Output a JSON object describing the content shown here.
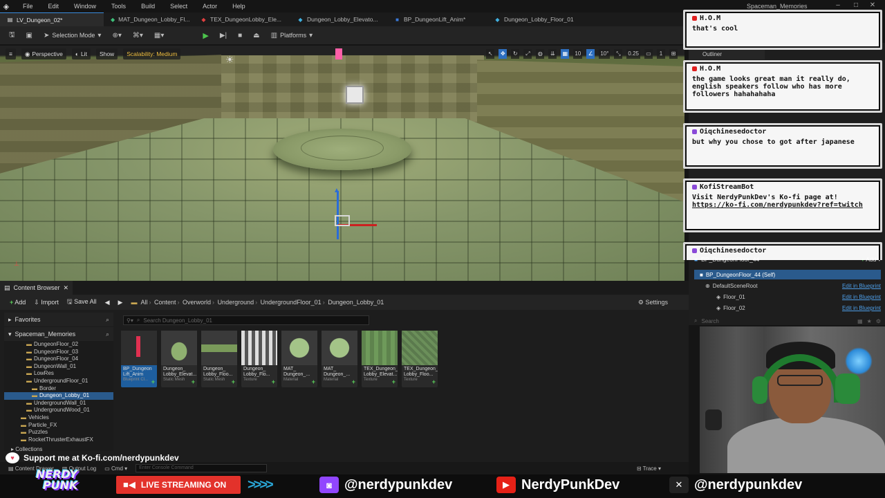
{
  "menu": {
    "items": [
      "File",
      "Edit",
      "Window",
      "Tools",
      "Build",
      "Select",
      "Actor",
      "Help"
    ]
  },
  "window_title": "Spaceman_Memories",
  "tabs": [
    {
      "label": "LV_Dungeon_02*",
      "icon": "level-icon",
      "color": "#e0e0e0"
    },
    {
      "label": "MAT_Dungeon_Lobby_Fl...",
      "icon": "material-icon",
      "color": "#3ec07a"
    },
    {
      "label": "TEX_DungeonLobby_Ele...",
      "icon": "texture-icon",
      "color": "#e04040"
    },
    {
      "label": "Dungeon_Lobby_Elevato...",
      "icon": "mesh-icon",
      "color": "#40b0e0"
    },
    {
      "label": "BP_DungeonLift_Anim*",
      "icon": "blueprint-icon",
      "color": "#3a78d8"
    },
    {
      "label": "Dungeon_Lobby_Floor_01",
      "icon": "mesh-icon",
      "color": "#40b0e0"
    }
  ],
  "toolbar": {
    "selection_mode": "Selection Mode",
    "platforms": "Platforms"
  },
  "viewport": {
    "perspective": "Perspective",
    "lit": "Lit",
    "show": "Show",
    "scalability": "Scalability: Medium",
    "grid_size": "10",
    "rotation_snap": "10°",
    "scale_snap": "0.25",
    "camera_speed": "1"
  },
  "content_browser": {
    "tab_label": "Content Browser",
    "add": "Add",
    "import": "Import",
    "save_all": "Save All",
    "settings": "Settings",
    "breadcrumb": [
      "All",
      "Content",
      "Overworld",
      "Underground",
      "UndergroundFloor_01",
      "Dungeon_Lobby_01"
    ],
    "search_placeholder": "Search Dungeon_Lobby_01",
    "favorites": "Favorites",
    "project": "Spaceman_Memories",
    "tree": [
      {
        "label": "DungeonFloor_02",
        "indent": 1
      },
      {
        "label": "DungeonFloor_03",
        "indent": 1
      },
      {
        "label": "DungeonFloor_04",
        "indent": 1
      },
      {
        "label": "DungeonWall_01",
        "indent": 1
      },
      {
        "label": "LowRes",
        "indent": 1
      },
      {
        "label": "UndergroundFloor_01",
        "indent": 1
      },
      {
        "label": "Border",
        "indent": 2
      },
      {
        "label": "Dungeon_Lobby_01",
        "indent": 2,
        "selected": true
      },
      {
        "label": "UndergroundWall_01",
        "indent": 1
      },
      {
        "label": "UndergroundWood_01",
        "indent": 1
      },
      {
        "label": "Vehicles",
        "indent": 0
      },
      {
        "label": "Particle_FX",
        "indent": 0
      },
      {
        "label": "Puzzles",
        "indent": 0
      },
      {
        "label": "RocketThrusterExhaustFX",
        "indent": 0
      }
    ],
    "collections": "Collections",
    "assets": [
      {
        "name": "BP_Dungeon Lift_Anim",
        "type": "Blueprint Cl...",
        "selected": true,
        "thumb": "blueprint"
      },
      {
        "name": "Dungeon_ Lobby_Elevat...",
        "type": "Static Mesh",
        "thumb": "mesh"
      },
      {
        "name": "Dungeon_ Lobby_Floo...",
        "type": "Static Mesh",
        "thumb": "mesh2"
      },
      {
        "name": "Dungeon_ Lobby_Flo...",
        "type": "Texture",
        "thumb": "checker"
      },
      {
        "name": "MAT_ Dungeon_...",
        "type": "Material",
        "thumb": "sphere"
      },
      {
        "name": "MAT_ Dungeon_...",
        "type": "Material",
        "thumb": "sphere"
      },
      {
        "name": "TEX_Dungeon_ Lobby_Elevat...",
        "type": "Texture",
        "thumb": "green"
      },
      {
        "name": "TEX_Dungeon_ Lobby_Floo...",
        "type": "Texture",
        "thumb": "green2"
      }
    ],
    "status": {
      "content_drawer": "Content Drawer",
      "output_log": "Output Log",
      "cmd": "Cmd",
      "console_placeholder": "Enter Console Command",
      "trace": "Trace"
    }
  },
  "details": {
    "outliner": "Outliner",
    "actor": "BP_DungeonFloor_44",
    "add": "Add",
    "components": [
      {
        "label": "BP_DungeonFloor_44 (Self)",
        "selected": true,
        "link": ""
      },
      {
        "label": "DefaultSceneRoot",
        "link": "Edit in Blueprint"
      },
      {
        "label": "Floor_01",
        "link": "Edit in Blueprint"
      },
      {
        "label": "Floor_02",
        "link": "Edit in Blueprint"
      }
    ],
    "search": "Search"
  },
  "chat": [
    {
      "user": "H.O.M",
      "badge_color": "#e02020",
      "text": "that's cool"
    },
    {
      "user": "H.O.M",
      "badge_color": "#e02020",
      "text": "the game looks great man it really do, english speakers follow who has more followers hahahahaha"
    },
    {
      "user": "Oiqchinesedoctor",
      "badge_color": "#8a4ad8",
      "text": "but why you chose to got after japanese"
    },
    {
      "user": "KofiStreamBot",
      "badge_color": "#8a4ad8",
      "text": "Visit NerdyPunkDev's Ko-fi page at!",
      "link": "https://ko-fi.com/nerdypunkdev?ref=twitch"
    },
    {
      "user": "Oiqchinesedoctor",
      "badge_color": "#8a4ad8",
      "text": ""
    }
  ],
  "stream": {
    "kofi": "Support me at Ko-fi.com/nerdypunkdev",
    "brand_line1": "NERDY",
    "brand_line2": "PUNK",
    "live": "LIVE STREAMING ON",
    "twitch": "@nerdypunkdev",
    "youtube": "NerdyPunkDev",
    "x": "@nerdypunkdev",
    "colors": {
      "twitch": "#9146ff",
      "youtube": "#e62117",
      "live": "#e3322b",
      "chevrons": "#2aa7d8"
    }
  }
}
